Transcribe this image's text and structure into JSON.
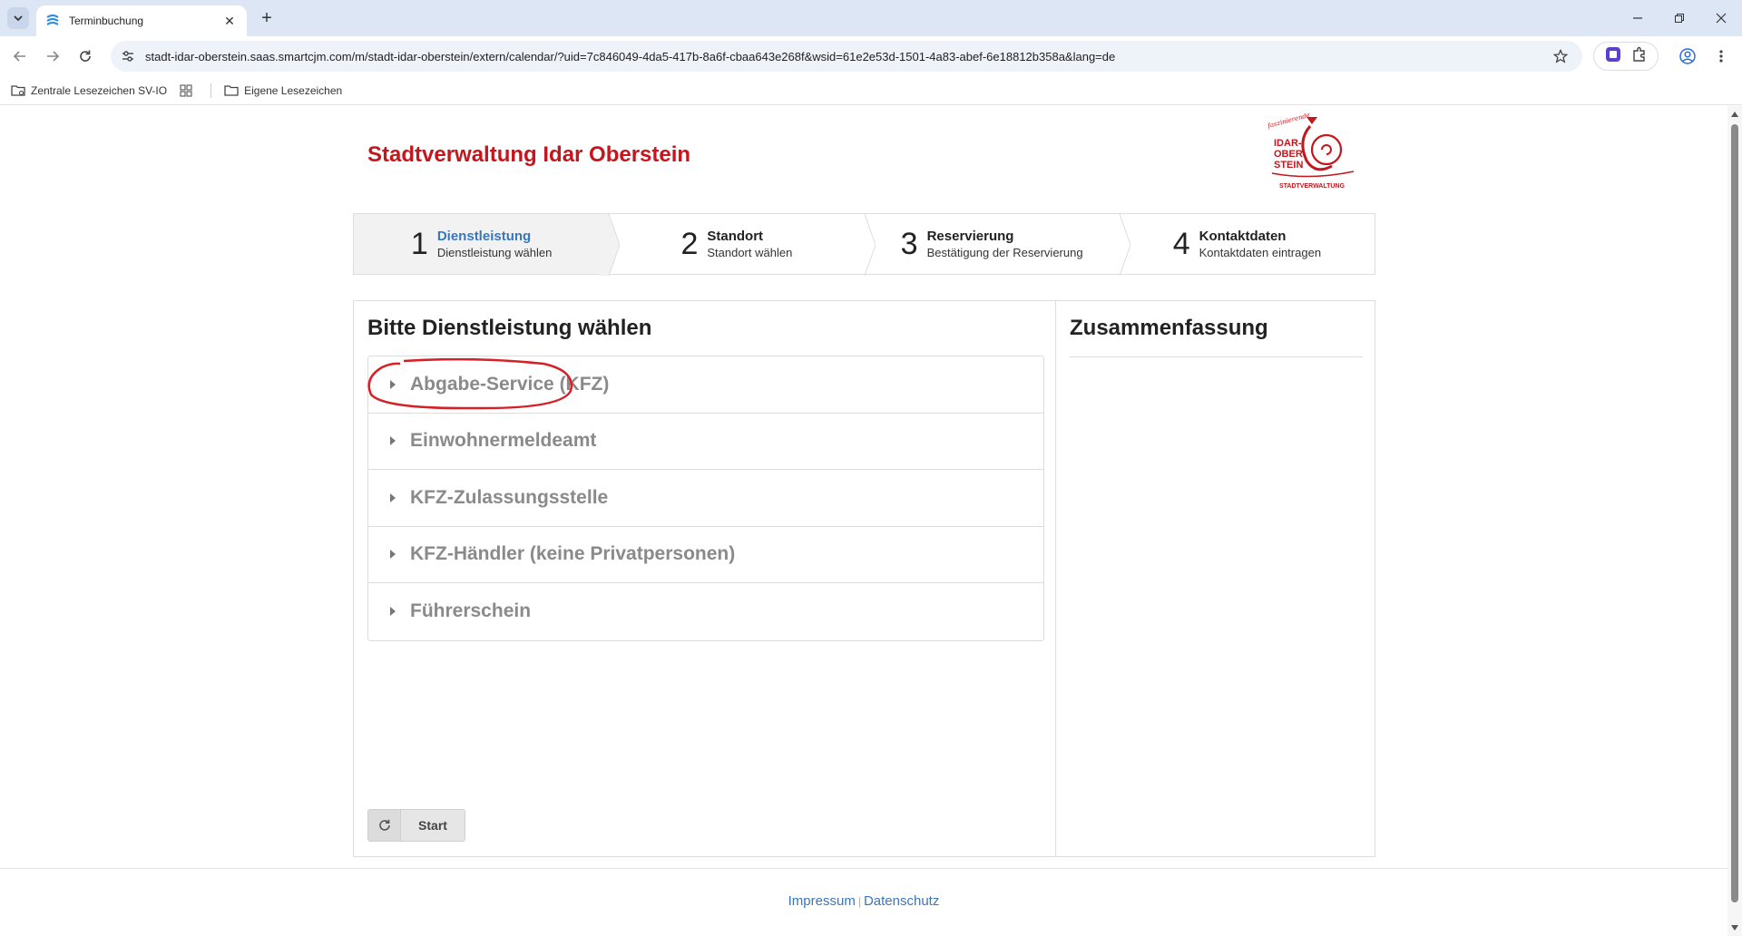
{
  "browser": {
    "tab_title": "Terminbuchung",
    "url": "stadt-idar-oberstein.saas.smartcjm.com/m/stadt-idar-oberstein/extern/calendar/?uid=7c846049-4da5-417b-8a6f-cbaa643e268f&wsid=61e2e53d-1501-4a83-abef-6e18812b358a&lang=de",
    "bookmarks": [
      "Zentrale Lesezeichen SV-IO",
      "Eigene Lesezeichen"
    ]
  },
  "header": {
    "site_title": "Stadtverwaltung Idar Oberstein",
    "logo_lines": [
      "IDAR-",
      "OBER",
      "STEIN",
      "STADTVERWALTUNG"
    ],
    "logo_script": "faszinierende"
  },
  "steps": [
    {
      "num": "1",
      "title": "Dienstleistung",
      "subtitle": "Dienstleistung wählen",
      "active": true
    },
    {
      "num": "2",
      "title": "Standort",
      "subtitle": "Standort wählen",
      "active": false
    },
    {
      "num": "3",
      "title": "Reservierung",
      "subtitle": "Bestätigung der Reservierung",
      "active": false
    },
    {
      "num": "4",
      "title": "Kontaktdaten",
      "subtitle": "Kontaktdaten eintragen",
      "active": false
    }
  ],
  "main": {
    "title": "Bitte Dienstleistung wählen",
    "services": [
      "Abgabe-Service (KFZ)",
      "Einwohnermeldeamt",
      "KFZ-Zulassungsstelle",
      "KFZ-Händler (keine Privatpersonen)",
      "Führerschein"
    ],
    "start_label": "Start"
  },
  "summary": {
    "title": "Zusammenfassung"
  },
  "footer": {
    "impressum": "Impressum",
    "separator": "|",
    "datenschutz": "Datenschutz"
  },
  "colors": {
    "brand_red": "#c4161c",
    "link_blue": "#3a76bd",
    "annotation_red": "#d61f26"
  }
}
